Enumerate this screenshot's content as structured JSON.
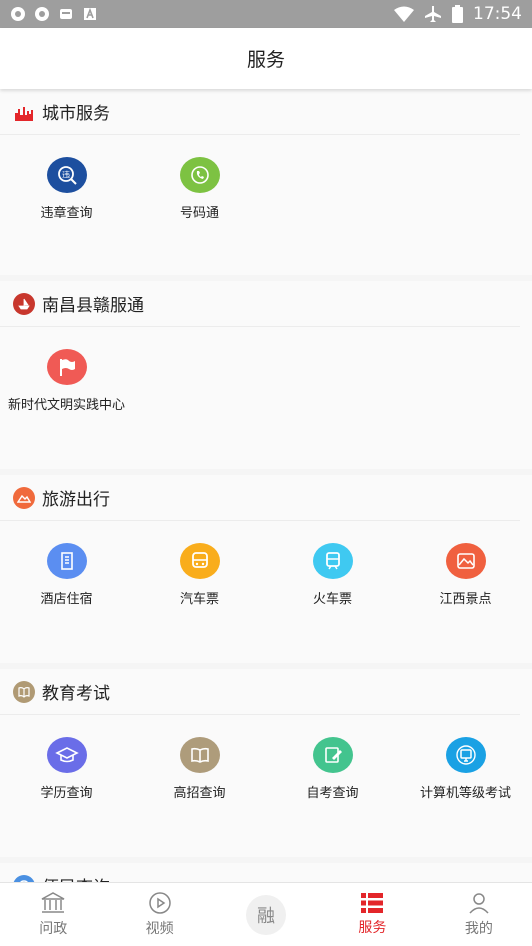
{
  "status_bar": {
    "time": "17:54",
    "left_icons": [
      "settings-gear-icon",
      "settings-gear-icon",
      "sim-icon",
      "font-a-icon"
    ],
    "right_icons": [
      "wifi-icon",
      "airplane-icon",
      "battery-icon"
    ]
  },
  "header": {
    "title": "服务"
  },
  "sections": [
    {
      "title": "城市服务",
      "icon": "city-skyline-icon",
      "color": "#e3262a",
      "items": [
        {
          "label": "违章查询",
          "icon": "violation-query-icon",
          "color": "#1d4f9f"
        },
        {
          "label": "号码通",
          "icon": "phone-icon",
          "color": "#7dc242"
        }
      ]
    },
    {
      "title": "南昌县赣服通",
      "icon": "ship-icon",
      "color": "#c8372d",
      "items": [
        {
          "label": "新时代文明实践中心",
          "icon": "flag-icon",
          "color": "#f05a55"
        }
      ]
    },
    {
      "title": "旅游出行",
      "icon": "mountain-icon",
      "color": "#f06a3c",
      "items": [
        {
          "label": "酒店住宿",
          "icon": "hotel-icon",
          "color": "#5b8ef1"
        },
        {
          "label": "汽车票",
          "icon": "bus-icon",
          "color": "#f9ad1c"
        },
        {
          "label": "火车票",
          "icon": "train-icon",
          "color": "#3fc9f1"
        },
        {
          "label": "江西景点",
          "icon": "scenic-spot-icon",
          "color": "#f0603f"
        }
      ]
    },
    {
      "title": "教育考试",
      "icon": "book-icon",
      "color": "#b09a74",
      "items": [
        {
          "label": "学历查询",
          "icon": "graduation-cap-icon",
          "color": "#6a6de8"
        },
        {
          "label": "高招查询",
          "icon": "open-book-icon",
          "color": "#ae9c7b"
        },
        {
          "label": "自考查询",
          "icon": "edit-note-icon",
          "color": "#43c48e"
        },
        {
          "label": "计算机等级考试",
          "icon": "computer-icon",
          "color": "#1aa1e4"
        }
      ]
    },
    {
      "title": "便民查询",
      "icon": "info-icon",
      "color": "#4a90e2",
      "items": []
    }
  ],
  "tabs": [
    {
      "label": "问政",
      "icon": "government-building-icon",
      "active": false
    },
    {
      "label": "视频",
      "icon": "play-circle-icon",
      "active": false
    },
    {
      "label": "",
      "center_text": "融",
      "icon": "rong-center-icon",
      "active": false
    },
    {
      "label": "服务",
      "icon": "service-list-icon",
      "active": true
    },
    {
      "label": "我的",
      "icon": "user-icon",
      "active": false
    }
  ],
  "colors": {
    "accent": "#e3262a",
    "background": "#f5f5f5"
  }
}
